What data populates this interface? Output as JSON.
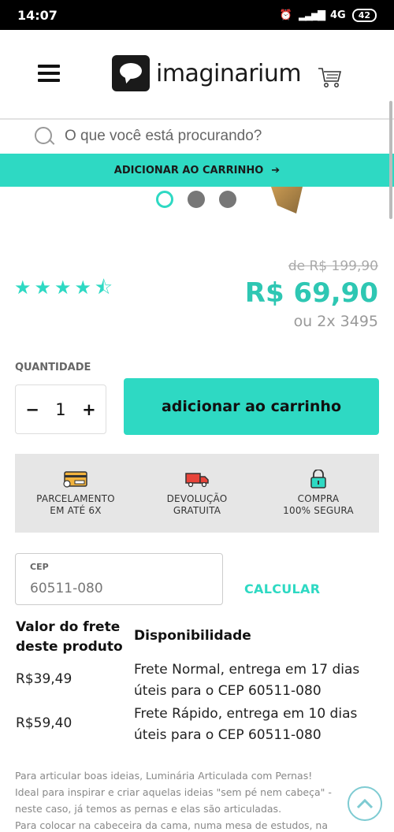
{
  "status_bar": {
    "time": "14:07",
    "network": "4G",
    "battery": "42"
  },
  "header": {
    "logo_text": "imaginarium"
  },
  "search": {
    "placeholder": "O que você está procurando?"
  },
  "sticky_cart": {
    "label": "ADICIONAR AO CARRINHO",
    "arrow": "➔"
  },
  "gallery": {
    "dot_count": 3,
    "active_index": 0
  },
  "rating": {
    "value": 4.5,
    "max": 5
  },
  "pricing": {
    "old_price": "de R$ 199,90",
    "price": "R$ 69,90",
    "installments": "ou 2x 3495"
  },
  "quantity": {
    "label": "QUANTIDADE",
    "value": "1",
    "minus": "−",
    "plus": "+"
  },
  "add_to_cart": {
    "label": "adicionar ao carrinho"
  },
  "benefits": [
    {
      "icon": "card-icon",
      "line1": "PARCELAMENTO",
      "line2": "EM ATÉ 6X"
    },
    {
      "icon": "truck-icon",
      "line1": "DEVOLUÇÃO",
      "line2": "GRATUITA"
    },
    {
      "icon": "lock-icon",
      "line1": "COMPRA",
      "line2": "100% SEGURA"
    }
  ],
  "cep": {
    "label": "CEP",
    "value": "60511-080",
    "button": "CALCULAR"
  },
  "shipping": {
    "col1_line1": "Valor do frete",
    "col1_line2": "deste produto",
    "col2": "Disponibilidade",
    "rows": [
      {
        "price": "R$39,49",
        "line1": "Frete Normal, entrega em 17 dias",
        "line2": "úteis para o CEP 60511-080"
      },
      {
        "price": "R$59,40",
        "line1": "Frete Rápido, entrega em 10 dias",
        "line2": "úteis para o CEP 60511-080"
      }
    ]
  },
  "description": {
    "lines": [
      "Para articular boas ideias, Luminária Articulada com Pernas!",
      "Ideal para inspirar e criar aquelas ideias \"sem pé nem cabeça\" -",
      "neste caso, já temos as pernas e elas são articuladas.",
      "Para colocar na cabeceira da cama, numa mesa de estudos, na"
    ]
  },
  "colors": {
    "accent": "#2ed9c3",
    "price": "#2ec7b3"
  }
}
